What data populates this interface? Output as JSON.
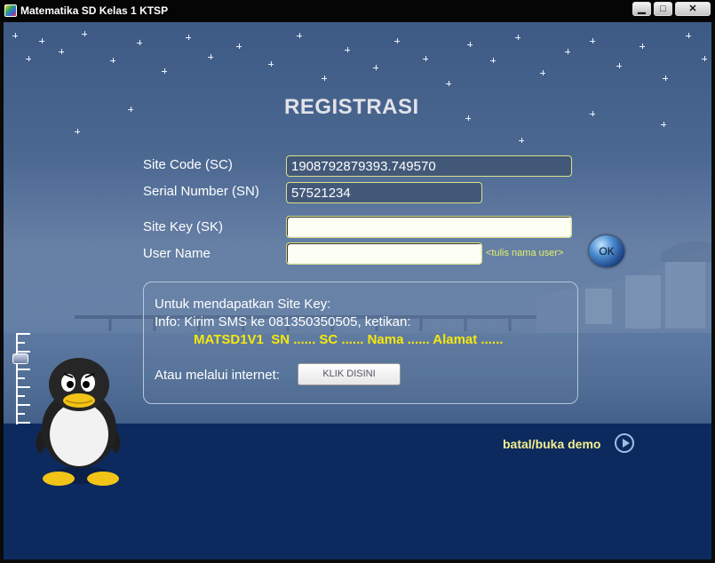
{
  "window": {
    "title": "Matematika SD Kelas 1 KTSP",
    "controls": {
      "minimize": "▁",
      "maximize": "□",
      "close": "✕"
    }
  },
  "form": {
    "heading": "REGISTRASI",
    "site_code": {
      "label": "Site Code (SC)",
      "value": "1908792879393.749570"
    },
    "serial_number": {
      "label": "Serial Number (SN)",
      "value": "57521234"
    },
    "site_key": {
      "label": "Site Key (SK)",
      "value": ""
    },
    "user_name": {
      "label": "User Name",
      "value": "",
      "hint": "<tulis nama user>"
    },
    "ok_label": "OK"
  },
  "info": {
    "line1": "Untuk  mendapatkan Site Key:",
    "line2": "Info: Kirim SMS ke 081350350505, ketikan:",
    "sms_format": "MATSD1V1  SN ...... SC ...... Nama ...... Alamat ......",
    "internet_label": "Atau melalui internet:",
    "internet_button": "KLIK DISINI"
  },
  "footer": {
    "demo_link": "batal/buka demo"
  },
  "icons": {
    "app": "app-logo-icon",
    "ok": "ok-globe-icon",
    "demo": "play-circle-icon",
    "mascot": "penguin-mascot-icon",
    "slider": "volume-slider-icon"
  },
  "colors": {
    "background_top": "#3d5a84",
    "bottom_panel": "#0d2a5e",
    "field_border": "#d9e08a",
    "sms_text": "#f6e80e",
    "hint_text": "#e2f06a",
    "demo_text": "#f2f08e"
  }
}
